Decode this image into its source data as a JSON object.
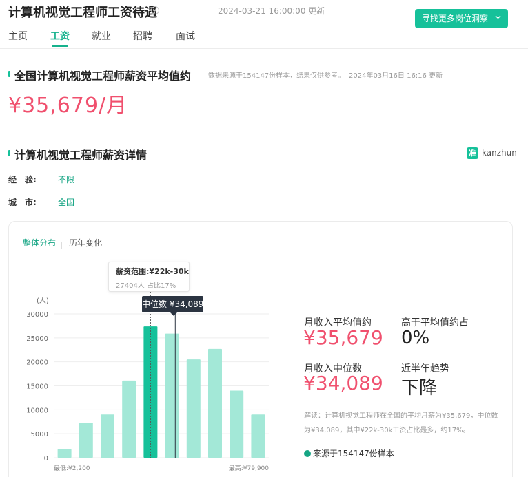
{
  "header": {
    "title": "计算机视觉工程师工资待遇",
    "help_icon": "?",
    "update_time": "2024-03-21 16:00:00 更新",
    "cta_label": "寻找更多岗位洞察",
    "cta_icon": "chevron-down-icon"
  },
  "tabs": [
    {
      "label": "主页",
      "active": false
    },
    {
      "label": "工资",
      "active": true
    },
    {
      "label": "就业",
      "active": false
    },
    {
      "label": "招聘",
      "active": false
    },
    {
      "label": "面试",
      "active": false
    }
  ],
  "avg_section": {
    "title": "全国计算机视觉工程师薪资平均值约",
    "note": "数据来源于154147份样本，结果仅供参考。",
    "note_time": "2024年03月16日 16:16 更新",
    "value": "¥35,679/月"
  },
  "detail_section": {
    "title": "计算机视觉工程师薪资详情",
    "logo_glyph": "准",
    "logo_text": "kanzhun",
    "filters": [
      {
        "label": "经　验:",
        "value": "不限"
      },
      {
        "label": "城　市:",
        "value": "全国"
      }
    ]
  },
  "chart_tabs": [
    {
      "label": "整体分布",
      "active": true
    },
    {
      "label": "历年变化",
      "active": false
    }
  ],
  "tooltip": {
    "title": "薪资范围:¥22k-30k",
    "detail": "27404人 占比17%"
  },
  "median_tag": "中位数 ¥34,089",
  "chart_data": {
    "type": "bar",
    "ylabel": "(人)",
    "ylim": [
      0,
      30000
    ],
    "yticks": [
      0,
      5000,
      10000,
      15000,
      20000,
      25000,
      30000
    ],
    "values": [
      1800,
      7300,
      9000,
      16100,
      27404,
      25900,
      20500,
      22700,
      14000,
      9000
    ],
    "highlight_index": 4,
    "median_after_index": 5,
    "min_label": "最低:¥2,200",
    "max_label": "最高:¥79,900",
    "grid": true,
    "colors": {
      "bar": "#a3e8d7",
      "highlight": "#16c19a",
      "grid": "#eeeeee",
      "axis_text": "#666666"
    }
  },
  "stats": {
    "avg_label": "月收入平均值约",
    "avg_value": "¥35,679",
    "above_label": "高于平均值约占",
    "above_value": "0%",
    "median_label": "月收入中位数",
    "median_value": "¥34,089",
    "trend_label": "近半年趋势",
    "trend_value": "下降",
    "explanation": "解读：计算机视觉工程师在全国的平均月薪为¥35,679，中位数为¥34,089，其中¥22k-30k工资占比最多，约17%。",
    "source": "来源于154147份样本"
  },
  "colors": {
    "accent": "#16c19a",
    "price": "#f0506e"
  }
}
